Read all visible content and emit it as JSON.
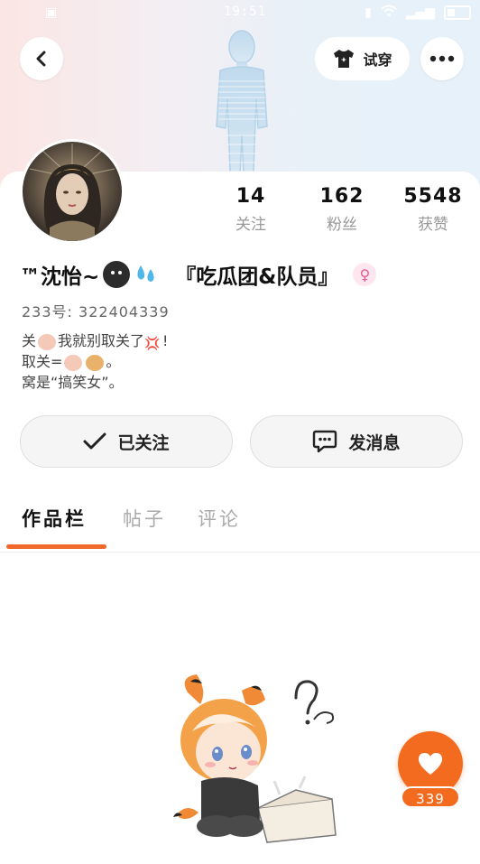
{
  "status_bar": {
    "time": "19:51",
    "battery": "",
    "signal": ""
  },
  "header": {
    "try_on_label": "试穿"
  },
  "profile": {
    "name": "™沈怡~",
    "group_tag": "『吃瓜团&队员』",
    "uid_label": "233号:",
    "uid_value": "322404339",
    "bio_line1_a": "关",
    "bio_line1_b": "我就别取关了",
    "bio_line1_c": "!",
    "bio_line2": "取关=",
    "bio_line2_end": "。",
    "bio_line3": "窝是“搞笑女”。",
    "gender": "female"
  },
  "stats": [
    {
      "value": "14",
      "label": "关注"
    },
    {
      "value": "162",
      "label": "粉丝"
    },
    {
      "value": "5548",
      "label": "获赞"
    }
  ],
  "actions": {
    "follow_label": "已关注",
    "message_label": "发消息"
  },
  "tabs": [
    {
      "label": "作品栏",
      "active": true
    },
    {
      "label": "帖子",
      "active": false
    },
    {
      "label": "评论",
      "active": false
    }
  ],
  "like": {
    "count": "339"
  },
  "colors": {
    "accent": "#f36b1f",
    "tab_indicator": "#f0682a",
    "female": "#e55a8e"
  }
}
